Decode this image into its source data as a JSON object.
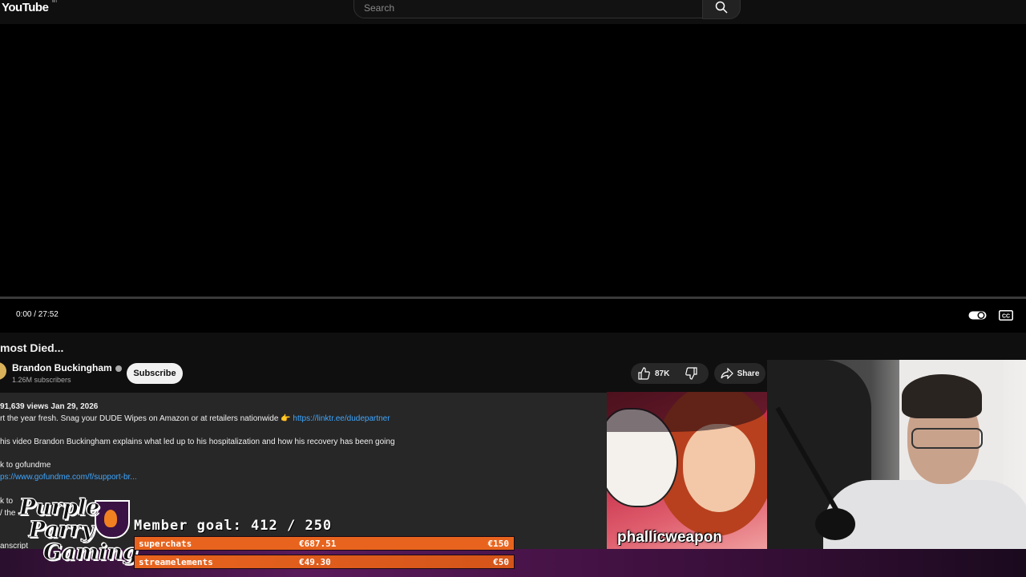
{
  "header": {
    "logo_text": "YouTube",
    "logo_region": "MT",
    "search_placeholder": "Search"
  },
  "player": {
    "time": "0:00 / 27:52"
  },
  "video": {
    "title": "most Died...",
    "channel_name": "Brandon Buckingham",
    "subscribers": "1.26M subscribers",
    "subscribe_label": "Subscribe",
    "likes": "87K",
    "share_label": "Share"
  },
  "description": {
    "meta": "91,639 views  Jan 29, 2026",
    "line1": "rt the year fresh. Snag your DUDE Wipes on Amazon or at retailers nationwide 👉 ",
    "line1_link": "https://linktr.ee/dudepartner",
    "line2": "his video Brandon Buckingham explains what led up to his hospitalization and how his recovery has been going",
    "line3": "k to gofundme",
    "line4_link": "ps://www.gofundme.com/f/support-br...",
    "line5": "k to",
    "line6": "/ the",
    "line7": "anscript"
  },
  "overlay": {
    "art_name": "phallicweapon",
    "logo_line1": "Purple",
    "logo_line2": "Parry",
    "logo_line3": "Gaming",
    "goal_text": "Member goal: 412 / 250",
    "rows": [
      {
        "label": "superchats",
        "amount": "€687.51",
        "target": "€150"
      },
      {
        "label": "streamelements",
        "amount": "€49.30",
        "target": "€50"
      }
    ]
  },
  "colors": {
    "background": "#0f0f0f",
    "link": "#3ea6ff",
    "goal_bar": "#e8641e"
  }
}
